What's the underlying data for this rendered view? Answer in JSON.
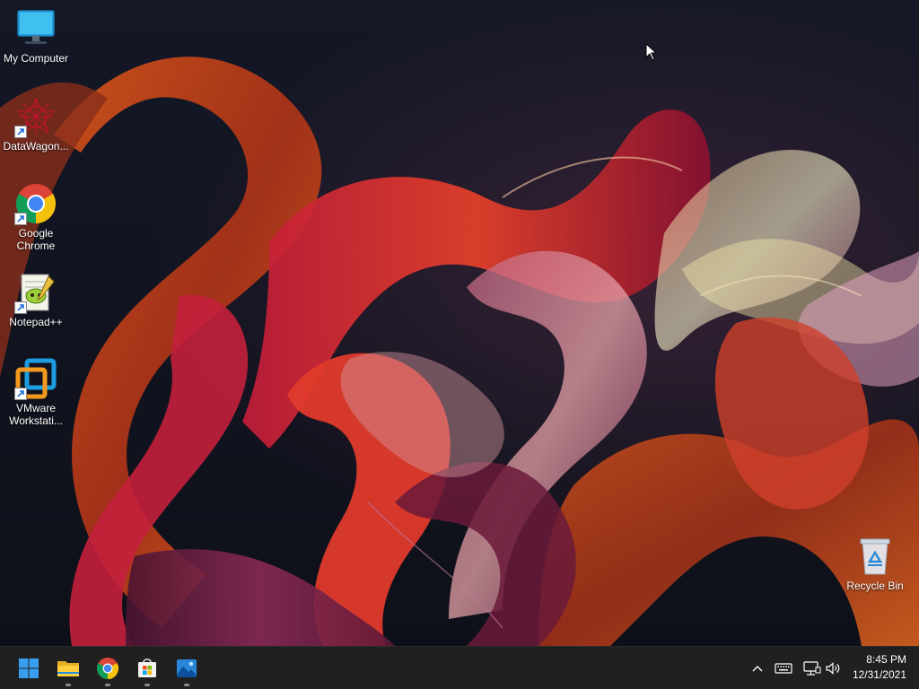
{
  "desktop_icons": [
    {
      "label": "My Computer",
      "icon": "monitor-icon",
      "shortcut": false
    },
    {
      "label": "DataWagon...",
      "icon": "datawagon-icon",
      "shortcut": true
    },
    {
      "label": "Google Chrome",
      "icon": "chrome-icon",
      "shortcut": true
    },
    {
      "label": "Notepad++",
      "icon": "notepadpp-icon",
      "shortcut": true
    },
    {
      "label": "VMware Workstati...",
      "icon": "vmware-icon",
      "shortcut": true
    },
    {
      "label": "Recycle Bin",
      "icon": "recycle-bin-icon",
      "shortcut": false
    }
  ],
  "taskbar": {
    "pinned": [
      {
        "name": "Start",
        "icon": "windows-start-icon",
        "running": false
      },
      {
        "name": "File Explorer",
        "icon": "file-explorer-icon",
        "running": true
      },
      {
        "name": "Google Chrome",
        "icon": "chrome-icon",
        "running": true
      },
      {
        "name": "Microsoft Store",
        "icon": "store-icon",
        "running": true
      },
      {
        "name": "Photos",
        "icon": "photos-icon",
        "running": true
      }
    ],
    "tray": [
      "chevron-up-icon",
      "keyboard-icon",
      "network-icon",
      "volume-icon"
    ],
    "clock": {
      "time": "8:45 PM",
      "date": "12/31/2021"
    }
  },
  "colors": {
    "taskbar": "#202020",
    "accent": "#0078d4"
  }
}
